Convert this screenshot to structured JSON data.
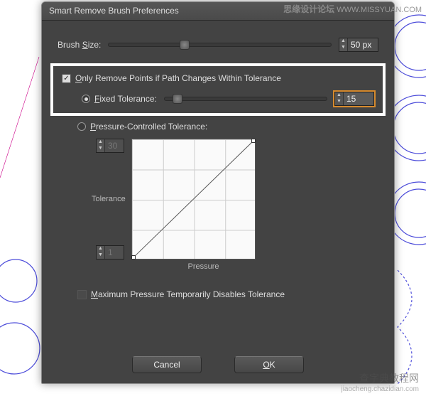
{
  "watermark": {
    "cn": "思缘设计论坛",
    "url": "WWW.MISSYUAN.COM",
    "bot": "查字典教程网",
    "boturl": "jiaocheng.chazidian.com"
  },
  "title": "Smart Remove Brush Preferences",
  "brush": {
    "label": "Brush Size:",
    "value": "50 px"
  },
  "opt": {
    "checkbox": "Only Remove Points if Path Changes Within Tolerance",
    "fixed": "Fixed Tolerance:",
    "fixed_val": "15",
    "pressure": "Pressure-Controlled Tolerance:"
  },
  "spin_top": "30",
  "spin_bot": "1",
  "axis": {
    "y": "Tolerance",
    "x": "Pressure"
  },
  "maxpress": "Maximum Pressure Temporarily Disables Tolerance",
  "buttons": {
    "cancel": "Cancel",
    "ok": "OK"
  }
}
